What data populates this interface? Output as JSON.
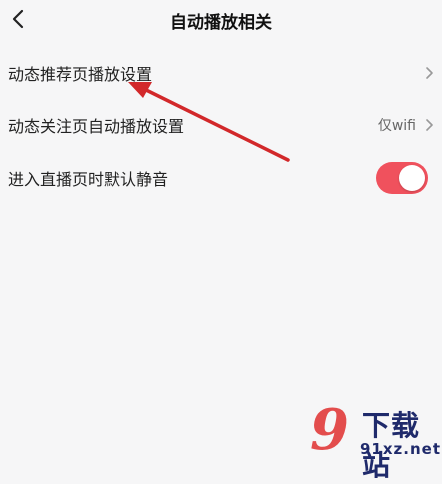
{
  "header": {
    "title": "自动播放相关",
    "back_icon": "back-arrow-icon"
  },
  "settings": {
    "items": [
      {
        "label": "动态推荐页播放设置",
        "value": ""
      },
      {
        "label": "动态关注页自动播放设置",
        "value": "仅wifi"
      },
      {
        "label": "进入直播页时默认静音",
        "toggle_on": true
      }
    ]
  },
  "colors": {
    "accent": "#f0515d",
    "annotation_arrow": "#d2282a",
    "background": "#f6f6f7"
  },
  "watermark": {
    "logo_text": "9",
    "top_text": "下载站",
    "bottom_text": "91xz.net"
  }
}
